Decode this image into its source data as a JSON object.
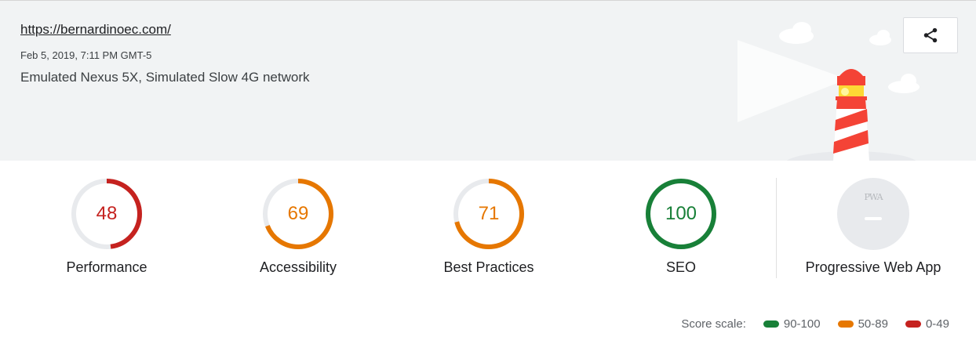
{
  "header": {
    "url": "https://bernardinoec.com/",
    "date": "Feb 5, 2019, 7:11 PM GMT-5",
    "environment": "Emulated Nexus 5X, Simulated Slow 4G network"
  },
  "colors": {
    "fail": "#c5221f",
    "average": "#e67700",
    "pass": "#188038",
    "track": "#e8eaed",
    "header_bg": "#f1f3f4"
  },
  "gauges": [
    {
      "label": "Performance",
      "score": "48",
      "status": "fail"
    },
    {
      "label": "Accessibility",
      "score": "69",
      "status": "average"
    },
    {
      "label": "Best Practices",
      "score": "71",
      "status": "average"
    },
    {
      "label": "SEO",
      "score": "100",
      "status": "pass"
    }
  ],
  "pwa": {
    "label": "Progressive Web App",
    "badge_text": "PWA"
  },
  "scale": {
    "label": "Score scale:",
    "ranges": [
      {
        "text": "90-100",
        "status": "pass"
      },
      {
        "text": "50-89",
        "status": "average"
      },
      {
        "text": "0-49",
        "status": "fail"
      }
    ]
  },
  "icons": {
    "share": "share-icon",
    "lighthouse": "lighthouse-illustration"
  }
}
